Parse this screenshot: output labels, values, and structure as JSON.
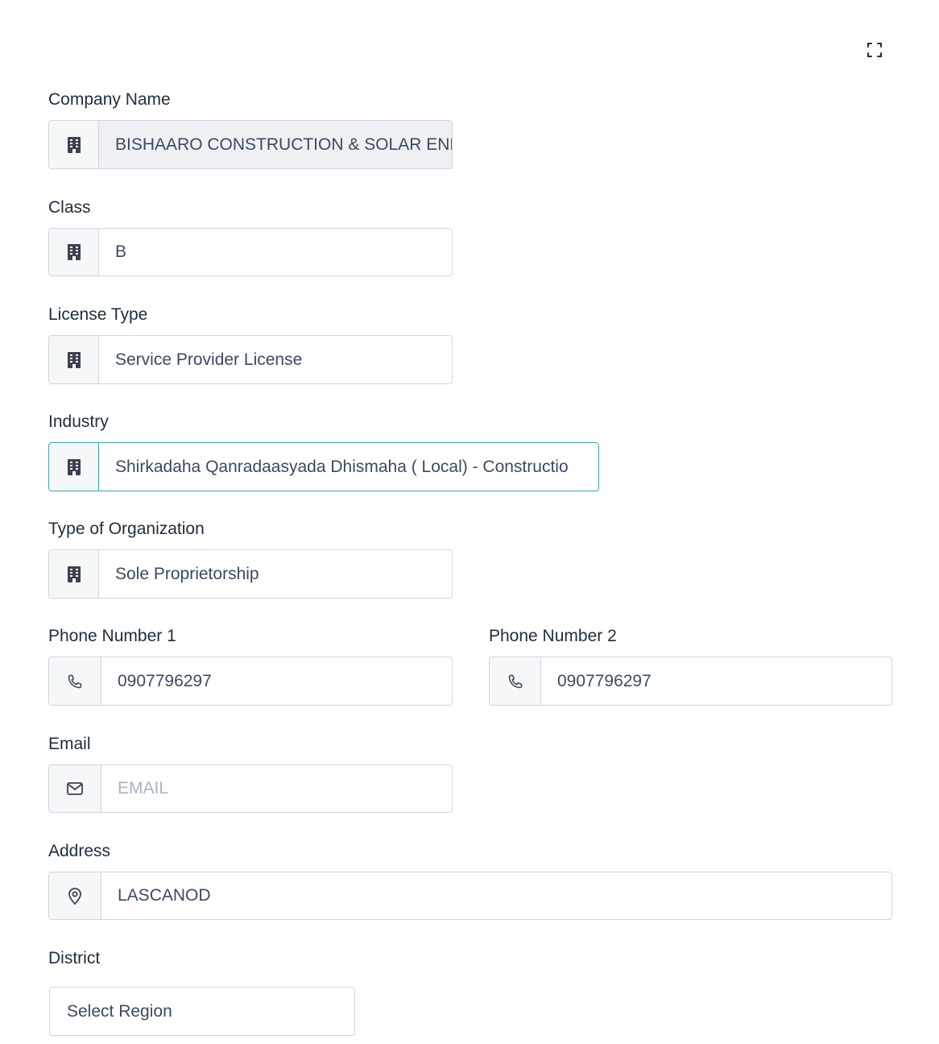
{
  "form": {
    "company_name": {
      "label": "Company Name",
      "value": "BISHAARO CONSTRUCTION & SOLAR ENE",
      "icon": "building-icon"
    },
    "class": {
      "label": "Class",
      "value": "B",
      "icon": "building-icon"
    },
    "license_type": {
      "label": "License Type",
      "value": "Service Provider License",
      "icon": "building-icon"
    },
    "industry": {
      "label": "Industry",
      "value": "Shirkadaha Qanradaasyada Dhismaha ( Local) - Constructio",
      "icon": "building-icon"
    },
    "organization_type": {
      "label": "Type of Organization",
      "value": "Sole Proprietorship",
      "icon": "building-icon"
    },
    "phone1": {
      "label": "Phone Number 1",
      "value": "0907796297",
      "icon": "phone-icon"
    },
    "phone2": {
      "label": "Phone Number 2",
      "value": "0907796297",
      "icon": "phone-icon"
    },
    "email": {
      "label": "Email",
      "value": "",
      "placeholder": "EMAIL",
      "icon": "mail-icon"
    },
    "address": {
      "label": "Address",
      "value": "LASCANOD",
      "icon": "map-pin-icon"
    },
    "district": {
      "label": "District",
      "selected": "Select Region"
    }
  },
  "colors": {
    "border": "#d1d6dd",
    "focus_border": "#3aa3b5",
    "addon_bg": "#f6f7f9",
    "disabled_bg": "#eef0f3",
    "text": "#3b4a61",
    "placeholder": "#a8b3c1"
  },
  "icons": {
    "expand": "expand-icon"
  }
}
